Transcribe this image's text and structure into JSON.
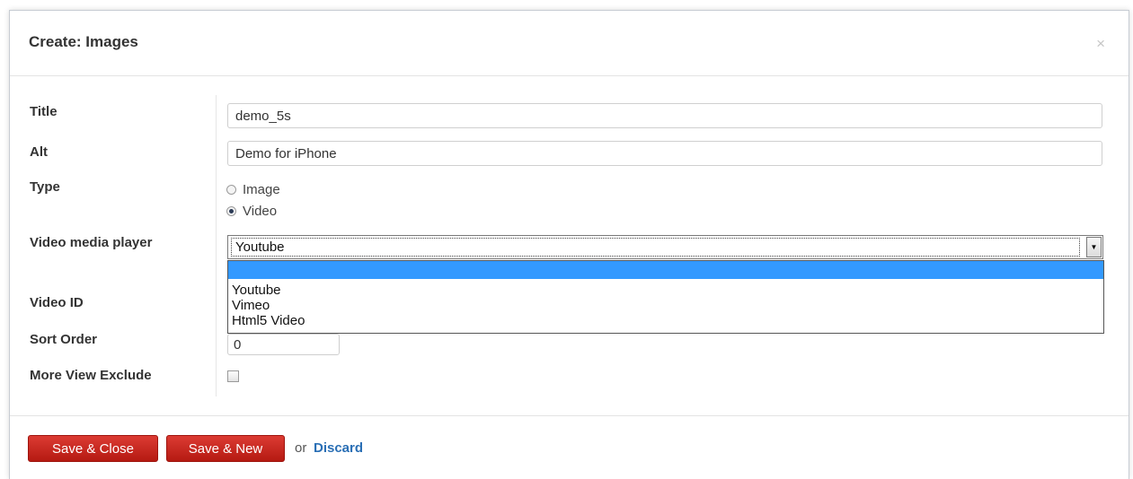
{
  "modal": {
    "title": "Create: Images",
    "close_glyph": "×"
  },
  "form": {
    "title_label": "Title",
    "title_value": "demo_5s",
    "alt_label": "Alt",
    "alt_value": "Demo for iPhone",
    "type_label": "Type",
    "type_options": [
      {
        "label": "Image",
        "checked": false
      },
      {
        "label": "Video",
        "checked": true
      }
    ],
    "player_label": "Video media player",
    "player_selected": "Youtube",
    "player_options": [
      "",
      "Youtube",
      "Vimeo",
      "Html5 Video"
    ],
    "video_id_label": "Video ID",
    "sort_order_label": "Sort Order",
    "sort_order_value": "0",
    "more_view_label": "More View Exclude",
    "more_view_checked": false
  },
  "footer": {
    "save_close": "Save & Close",
    "save_new": "Save & New",
    "or_text": "or",
    "discard": "Discard"
  },
  "icons": {
    "close": "close-icon",
    "dropdown": "chevron-down-icon"
  },
  "colors": {
    "button_red": "#c9261e",
    "link_blue": "#2a6fb5",
    "highlight": "#3399ff"
  }
}
